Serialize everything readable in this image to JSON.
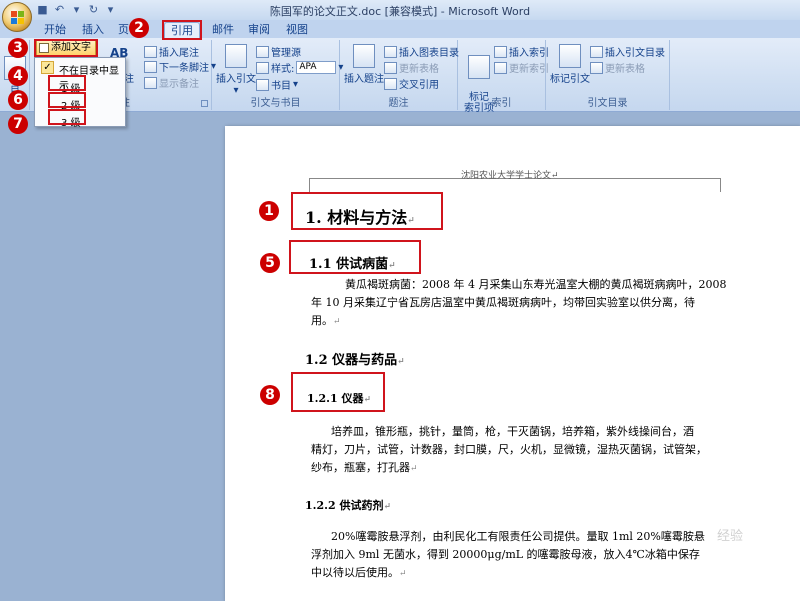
{
  "window": {
    "title": "陈国军的论文正文.doc [兼容模式] - Microsoft Word"
  },
  "tabs": [
    {
      "label": "开始"
    },
    {
      "label": "插入"
    },
    {
      "label": "页"
    },
    {
      "label": "引用"
    },
    {
      "label": "邮件"
    },
    {
      "label": "审阅"
    },
    {
      "label": "视图"
    }
  ],
  "ribbon": {
    "toc": {
      "add_text": "添加文字",
      "add_text_arrow": "▾",
      "toc_left": "目"
    },
    "footnotes": {
      "ab_icon": "AB",
      "insert_endnote": "插入尾注",
      "next_footnote": "下一条脚注",
      "show_notes": "显示备注",
      "footnote_partial": "注",
      "label": "脚注"
    },
    "citations": {
      "insert_citation": "插入引文",
      "manage_sources": "管理源",
      "style_label": "样式:",
      "style_value": "APA",
      "bibliography": "书目",
      "label": "引文与书目"
    },
    "captions": {
      "insert_caption": "插入题注",
      "insert_table_of_figures": "插入图表目录",
      "update_table": "更新表格",
      "cross_reference": "交叉引用",
      "label": "题注"
    },
    "index": {
      "mark_entry": "标记\n索引项",
      "insert_index": "插入索引",
      "update_index": "更新索引",
      "label": "索引"
    },
    "toa": {
      "mark_citation": "标记引文",
      "insert_toa": "插入引文目录",
      "update_table": "更新表格",
      "label": "引文目录"
    }
  },
  "dropdown": {
    "not_shown": "不在目录中显示",
    "level1": "1 级",
    "level2": "2 级",
    "level3": "3 级"
  },
  "badges": [
    "1",
    "2",
    "3",
    "4",
    "5",
    "6",
    "7",
    "8"
  ],
  "document": {
    "header": "沈阳农业大学学士论文↵",
    "h1": "1.  材料与方法",
    "h1_1": "1.1 供试病菌",
    "para1_line1": "黄瓜褐斑病菌：2008 年 4 月采集山东寿光温室大棚的黄瓜褐斑病病叶，2008",
    "para1_line2": "年 10 月采集辽宁省瓦房店温室中黄瓜褐斑病病叶，均带回实验室以供分离，待",
    "para1_line3": "用。",
    "h1_2": "1.2  仪器与药品",
    "h1_2_1": "1.2.1  仪器",
    "para2_line1": "培养皿，锥形瓶，挑针，量筒，枪，干灭菌锅，培养箱，紫外线操间台，酒",
    "para2_line2": "精灯，刀片，试管，计数器，封口膜，尺，火机，显微镜，湿热灭菌锅，试管架，",
    "para2_line3": "纱布，瓶塞，打孔器",
    "h1_2_2": "1.2.2 供试药剂",
    "para3_line1": "20%噻霉胺悬浮剂，由利民化工有限责任公司提供。量取 1ml 20%噻霉胺悬",
    "para3_line2": "浮剂加入 9ml 无菌水，得到 20000μg/mL 的噻霉胺母液，放入4℃冰箱中保存",
    "para3_line3": "中以待以后使用。"
  },
  "watermark": "经验"
}
